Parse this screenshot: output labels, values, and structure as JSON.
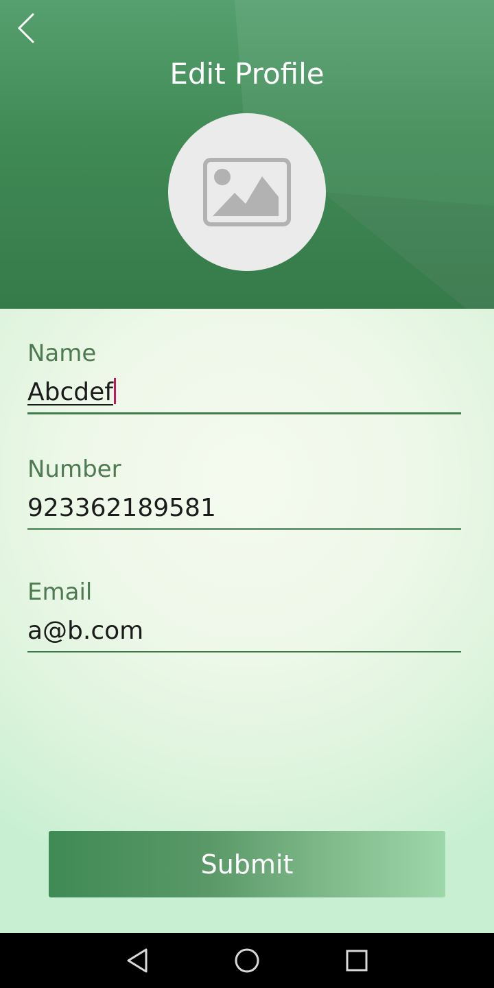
{
  "header": {
    "title": "Edit Profile",
    "back_icon": "chevron-left-icon",
    "avatar_icon": "image-placeholder-icon"
  },
  "form": {
    "name": {
      "label": "Name",
      "value": "Abcdef"
    },
    "number": {
      "label": "Number",
      "value": "923362189581"
    },
    "email": {
      "label": "Email",
      "value": "a@b.com"
    }
  },
  "submit_label": "Submit",
  "navbar": {
    "back_icon": "triangle-back-icon",
    "home_icon": "circle-home-icon",
    "recents_icon": "square-recents-icon"
  },
  "colors": {
    "header_green": "#3f8a55",
    "label_green": "#4e7a52",
    "caret": "#c2185b",
    "avatar_bg": "#ebebeb"
  }
}
